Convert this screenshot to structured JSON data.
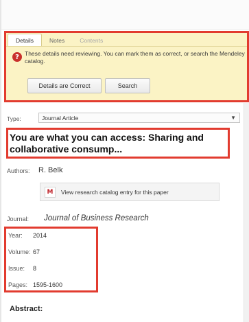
{
  "tabs": [
    {
      "label": "Details",
      "state": "active"
    },
    {
      "label": "Notes",
      "state": "normal"
    },
    {
      "label": "Contents",
      "state": "disabled"
    }
  ],
  "warning": {
    "icon": "question-icon",
    "text": "These details need reviewing. You can mark them as correct, or search the Mendeley catalog."
  },
  "buttons": {
    "correct": "Details are Correct",
    "search": "Search"
  },
  "type": {
    "label": "Type:",
    "value": "Journal Article"
  },
  "paper": {
    "title": "You are what you can access: Sharing and collaborative consump...",
    "authors_label": "Authors:",
    "authors": "R. Belk",
    "catalog_link": "View research catalog entry for this paper",
    "journal_label": "Journal:",
    "journal": "Journal of Business Research",
    "abstract_label": "Abstract:"
  },
  "meta": [
    {
      "label": "Year:",
      "value": "2014"
    },
    {
      "label": "Volume:",
      "value": "67"
    },
    {
      "label": "Issue:",
      "value": "8"
    },
    {
      "label": "Pages:",
      "value": "1595-1600"
    }
  ],
  "colors": {
    "highlight": "#e23b2f",
    "warning_bg": "#fbf3c5",
    "mendeley_red": "#c0262d"
  }
}
